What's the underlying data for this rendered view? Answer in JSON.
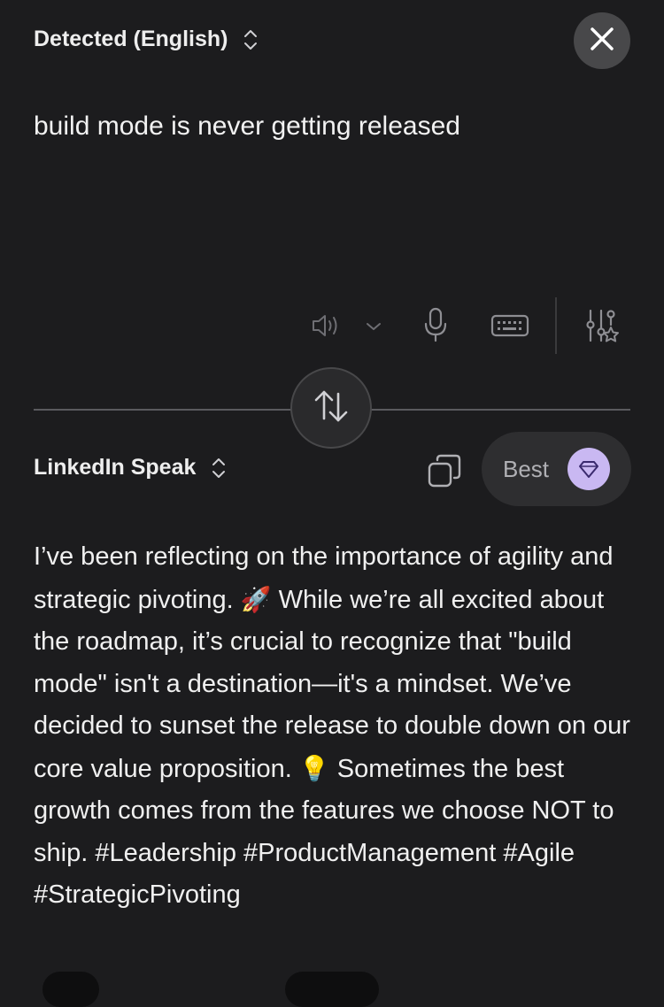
{
  "source": {
    "language_label": "Detected (English)",
    "text": "build mode is never getting released"
  },
  "target": {
    "language_label": "LinkedIn Speak",
    "quality_label": "Best",
    "segments": [
      "I’ve been reflecting on the importance of agility and strategic pivoting. ",
      "🚀",
      " While we’re all excited about the roadmap, it’s crucial to recognize that \"build mode\" isn't a destination—it's a mindset. We’ve decided to sunset the release to double down on our core value proposition. ",
      "💡",
      " Sometimes the best growth comes from the features we choose NOT to ship. #Leadership #ProductManagement #Agile #StrategicPivoting"
    ]
  },
  "icons": {
    "close": "close-icon",
    "updown": "chevron-up-down-icon",
    "speaker": "speaker-icon",
    "mic": "microphone-icon",
    "keyboard": "keyboard-icon",
    "adjust": "sliders-sparkle-icon",
    "swap": "swap-arrows-icon",
    "copy": "copy-icon",
    "gem": "diamond-icon"
  },
  "colors": {
    "background": "#1c1c1e",
    "text": "#f0f0f0",
    "icon": "#8e8e93",
    "accent_badge": "#c9b8f2"
  }
}
